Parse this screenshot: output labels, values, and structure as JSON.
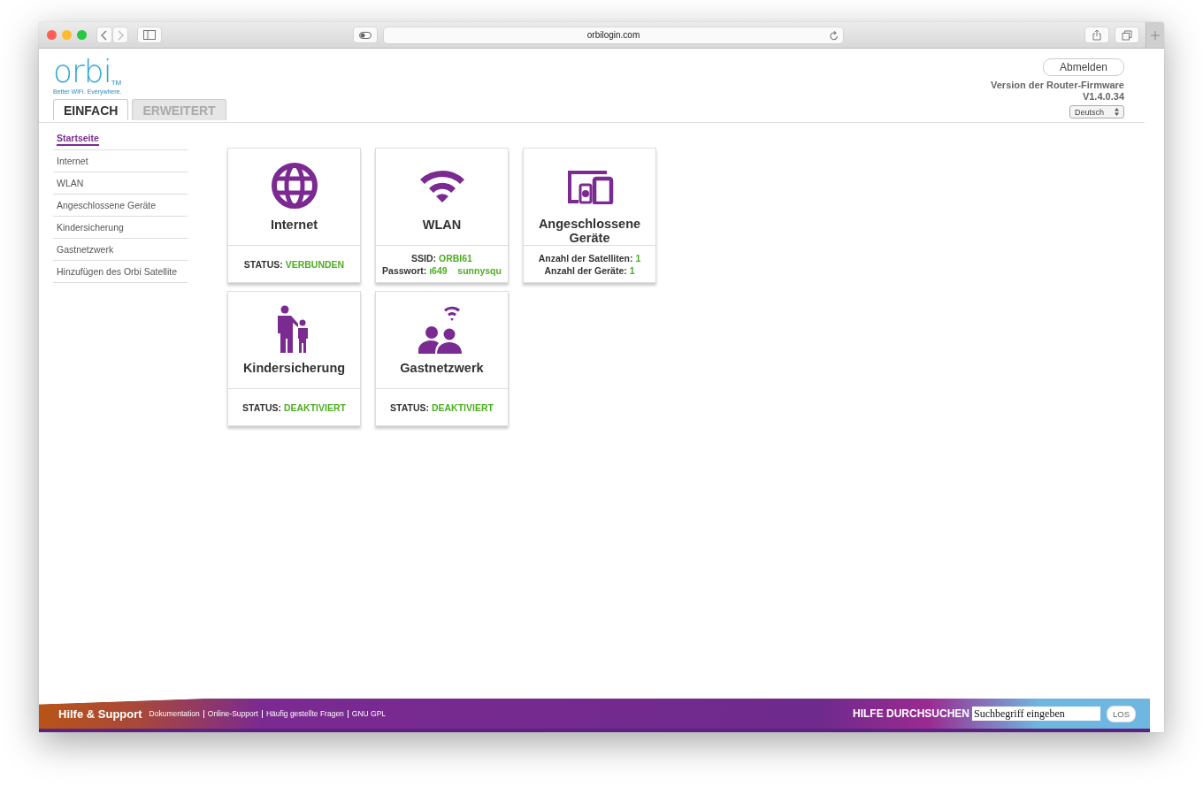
{
  "browser": {
    "url": "orbilogin.com"
  },
  "header": {
    "logo": "orbi",
    "trademark": "TM",
    "tagline": "Better WiFi. Everywhere.",
    "logout": "Abmelden",
    "firmware_label": "Version der Router-Firmware",
    "firmware_version": "V1.4.0.34",
    "language": "Deutsch"
  },
  "tabs": [
    {
      "label": "EINFACH",
      "selected": true
    },
    {
      "label": "ERWEITERT",
      "selected": false
    }
  ],
  "sidebar": {
    "items": [
      {
        "label": "Startseite",
        "selected": true
      },
      {
        "label": "Internet",
        "selected": false
      },
      {
        "label": "WLAN",
        "selected": false
      },
      {
        "label": "Angeschlossene Geräte",
        "selected": false
      },
      {
        "label": "Kindersicherung",
        "selected": false
      },
      {
        "label": "Gastnetzwerk",
        "selected": false
      },
      {
        "label": "Hinzufügen des Orbi Satellite",
        "selected": false
      }
    ]
  },
  "tiles": [
    {
      "kind": "globe",
      "title": "Internet",
      "lines": [
        {
          "label": "STATUS:",
          "value": "VERBUNDEN"
        }
      ]
    },
    {
      "kind": "wifi",
      "title": "WLAN",
      "lines": [
        {
          "label": "SSID:",
          "value": "ORBI61"
        },
        {
          "label": "Passwort:",
          "value": "ı649    sunnysqu"
        }
      ]
    },
    {
      "kind": "devices",
      "title": "Angeschlossene Geräte",
      "lines": [
        {
          "label": "Anzahl der Satelliten:",
          "value": "1"
        },
        {
          "label": "Anzahl der Geräte:",
          "value": "1"
        }
      ]
    },
    {
      "kind": "parent",
      "title": "Kindersicherung",
      "lines": [
        {
          "label": "STATUS:",
          "value": "DEAKTIVIERT"
        }
      ]
    },
    {
      "kind": "guest",
      "title": "Gastnetzwerk",
      "lines": [
        {
          "label": "STATUS:",
          "value": "DEAKTIVIERT"
        }
      ]
    }
  ],
  "footer": {
    "title": "Hilfe & Support",
    "links": [
      "Dokumentation",
      "Online-Support",
      "Häufig gestellte Fragen",
      "GNU GPL"
    ],
    "search_label": "HILFE DURCHSUCHEN",
    "search_placeholder": "Suchbegriff eingeben",
    "search_button": "LOS"
  }
}
